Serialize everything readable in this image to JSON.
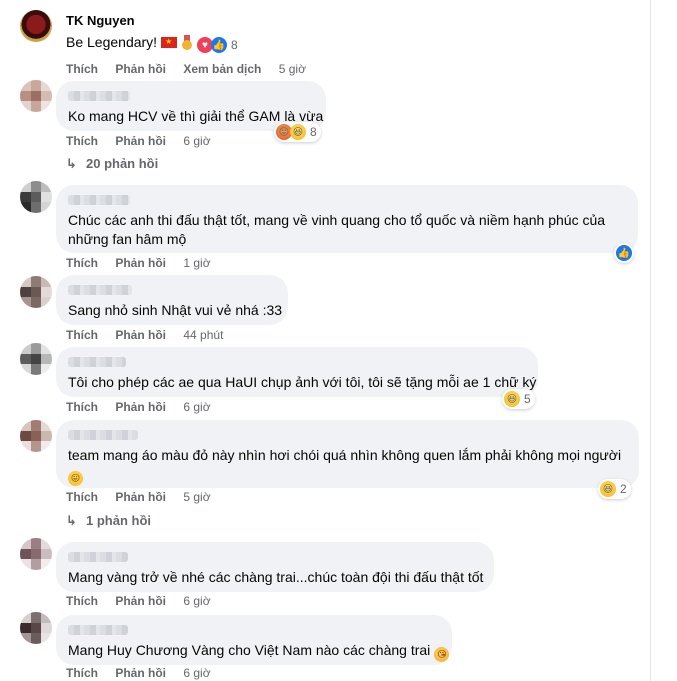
{
  "actions": {
    "like": "Thích",
    "reply": "Phản hồi",
    "translate": "Xem bản dịch"
  },
  "colors": {
    "bubble": "#f0f2f5",
    "meta": "#65676b",
    "like_blue": "#1877f2"
  },
  "comments": [
    {
      "author": "TK Nguyen",
      "text": "Be Legendary!",
      "time": "5 giờ",
      "reactions": {
        "icons": [
          "heart",
          "like"
        ],
        "count": "8"
      }
    },
    {
      "text": "Ko mang HCV về thì giải thể GAM là vừa",
      "time": "6 giờ",
      "reactions": {
        "icons": [
          "angry",
          "haha"
        ],
        "count": "8"
      },
      "replies": "20 phản hồi"
    },
    {
      "text_lines": [
        "Chúc các anh thi đấu thật tốt, mang về vinh quang cho tổ quốc và niềm hạnh phúc của",
        "những fan hâm mộ"
      ],
      "time": "1 giờ",
      "reactions": {
        "icons": [
          "like"
        ],
        "count": ""
      }
    },
    {
      "text": "Sang nhỏ sinh Nhật vui vẻ nhá :33",
      "time": "44 phút"
    },
    {
      "text": "Tôi cho phép các ae qua HaUI chụp ảnh với tôi, tôi sẽ tặng mỗi ae 1 chữ ký",
      "time": "6 giờ",
      "reactions": {
        "icons": [
          "haha"
        ],
        "count": "5"
      }
    },
    {
      "text_lines": [
        "team mang áo màu đỏ này nhìn hơi chói quá nhìn không quen lắm phải không mọi người",
        ""
      ],
      "time": "5 giờ",
      "reactions": {
        "icons": [
          "haha"
        ],
        "count": "2"
      },
      "replies": "1 phản hồi"
    },
    {
      "text": "Mang vàng trở về nhé các chàng trai...chúc toàn đội thi đấu thật tốt",
      "time": "6 giờ"
    },
    {
      "text": "Mang Huy Chương Vàng cho Việt Nam nào các chàng trai",
      "time": "6 giờ"
    }
  ]
}
